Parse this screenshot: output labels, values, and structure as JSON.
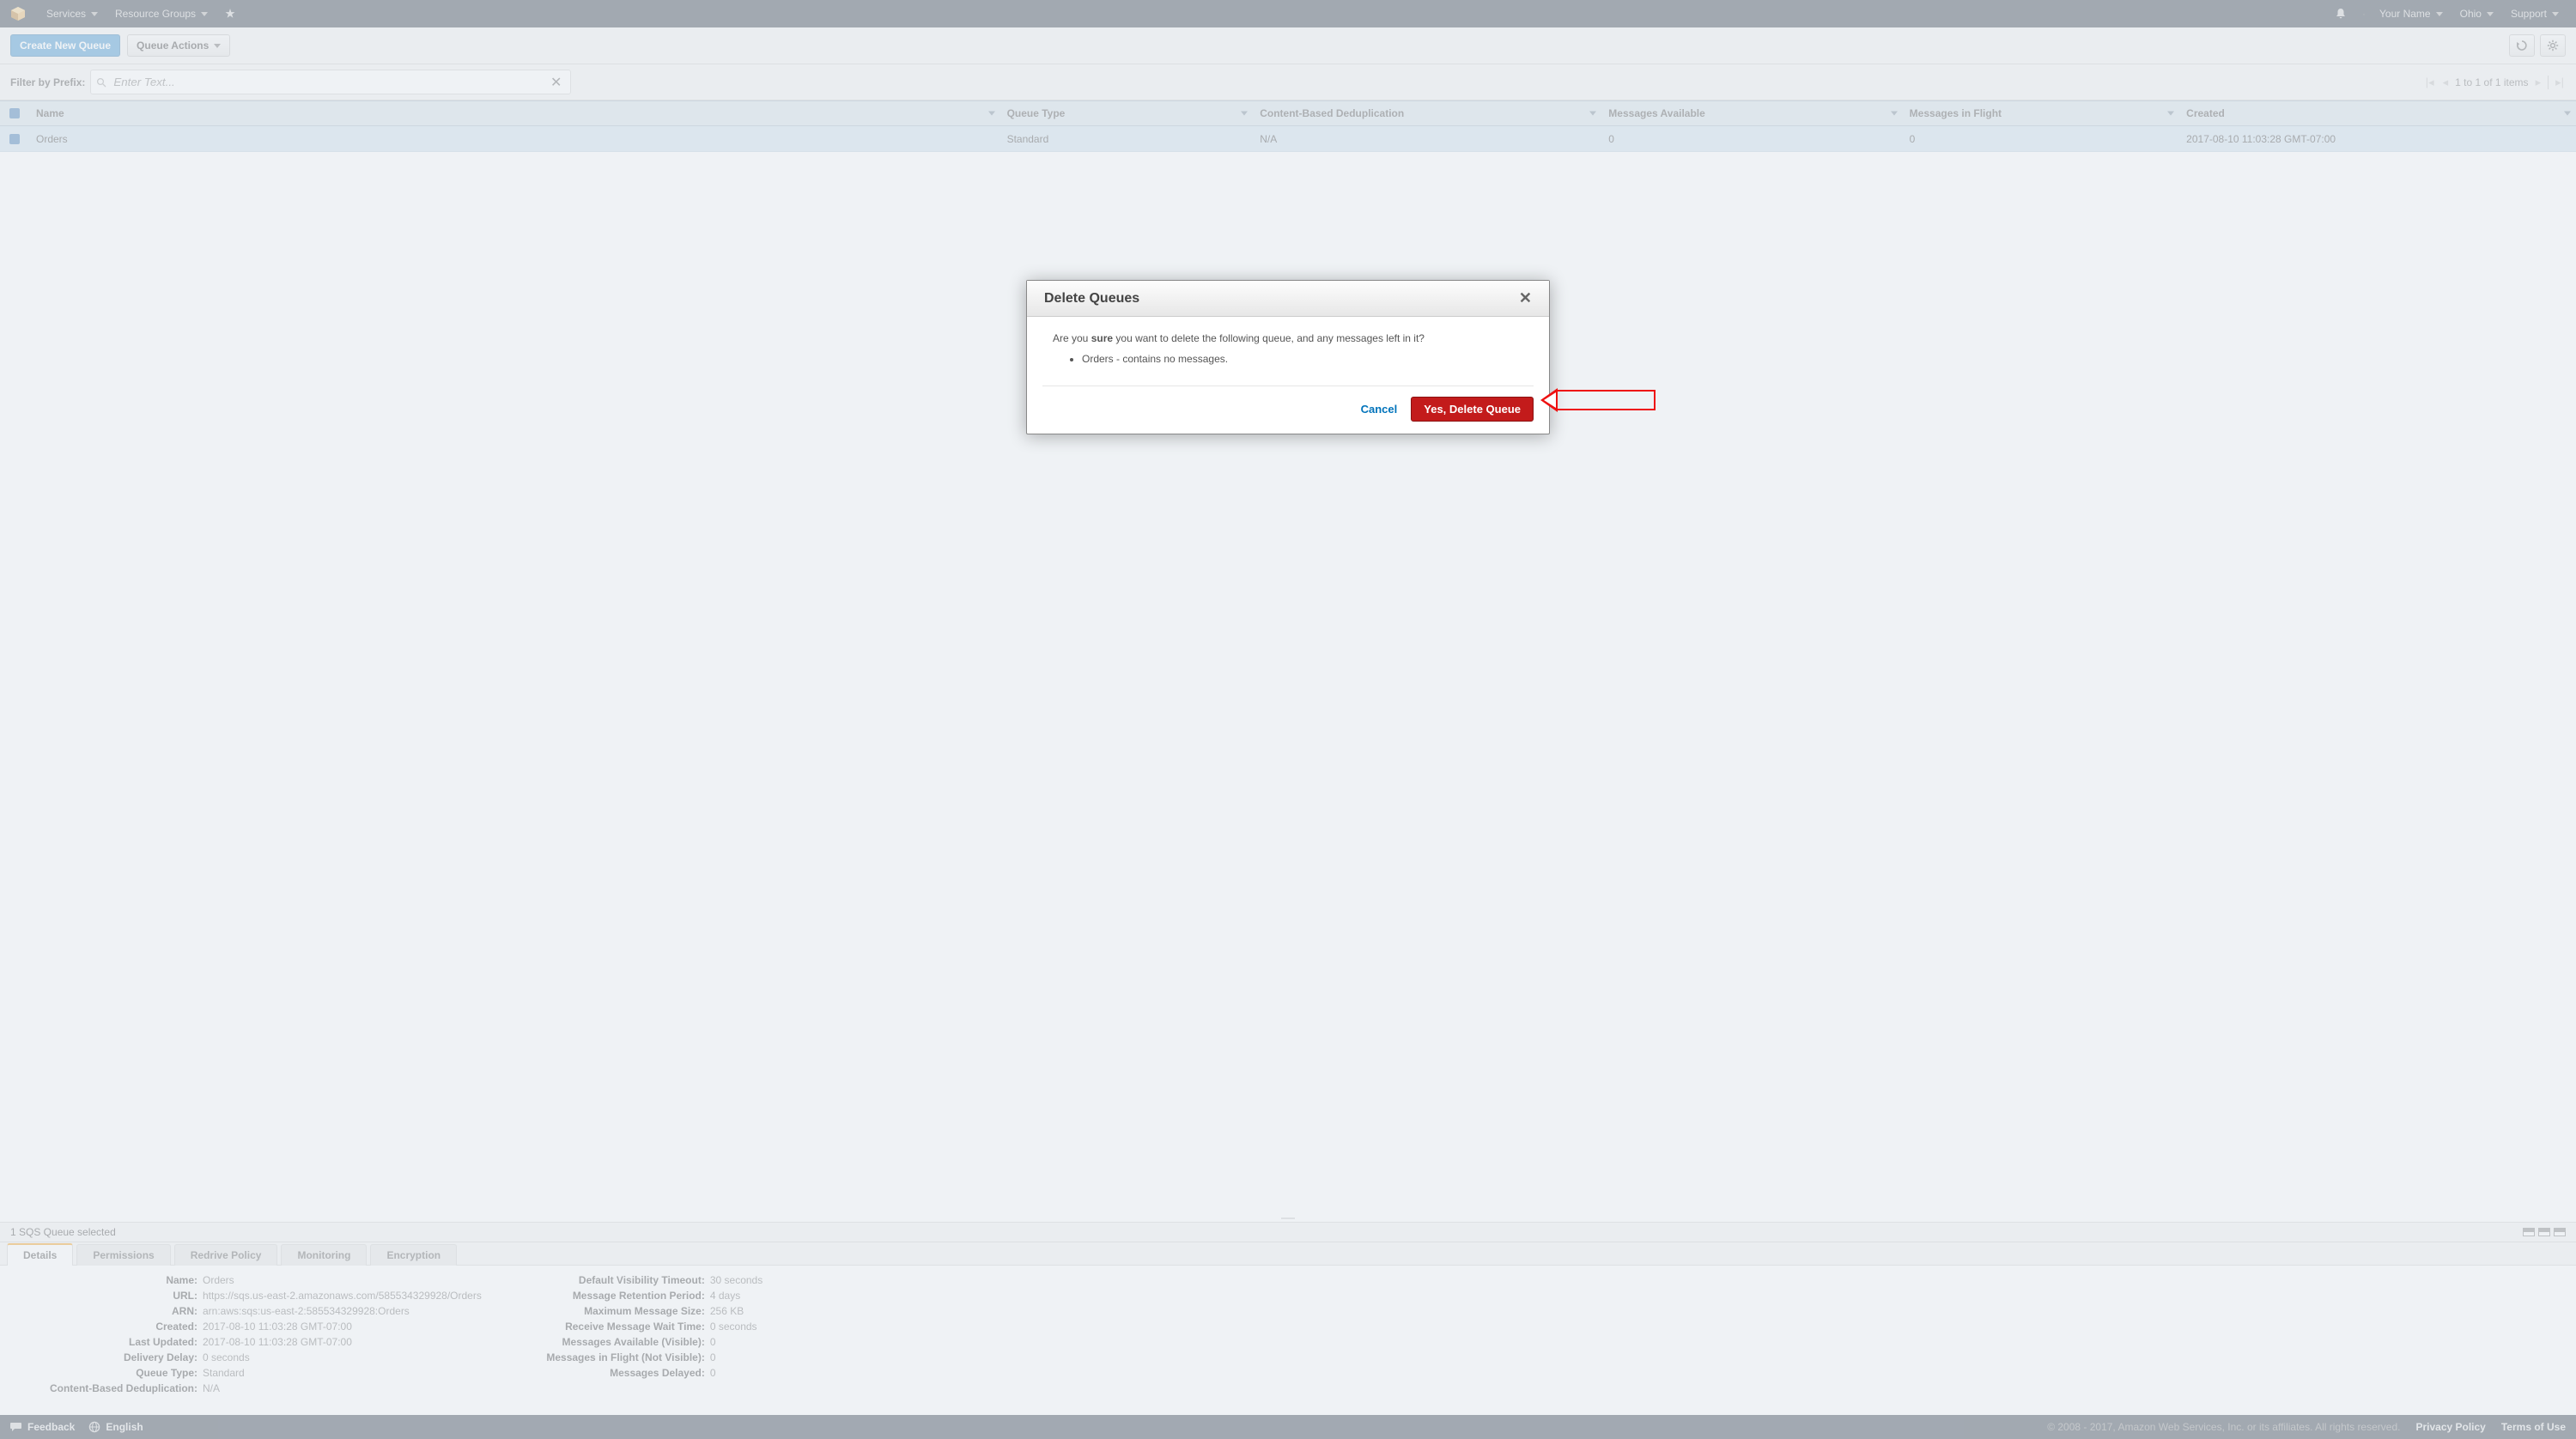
{
  "nav": {
    "services": "Services",
    "resource_groups": "Resource Groups",
    "your_name": "Your Name",
    "region": "Ohio",
    "support": "Support"
  },
  "toolbar": {
    "create": "Create New Queue",
    "actions": "Queue Actions"
  },
  "filter": {
    "label": "Filter by Prefix:",
    "placeholder": "Enter Text...",
    "pager": "1 to 1 of 1 items"
  },
  "columns": {
    "name": "Name",
    "type": "Queue Type",
    "dedup": "Content-Based Deduplication",
    "avail": "Messages Available",
    "flight": "Messages in Flight",
    "created": "Created"
  },
  "row": {
    "name": "Orders",
    "type": "Standard",
    "dedup": "N/A",
    "avail": "0",
    "flight": "0",
    "created": "2017-08-10 11:03:28 GMT-07:00"
  },
  "selbar": "1 SQS Queue selected",
  "tabs": {
    "details": "Details",
    "permissions": "Permissions",
    "redrive": "Redrive Policy",
    "monitoring": "Monitoring",
    "encryption": "Encryption"
  },
  "details": {
    "left": {
      "Name:": "Orders",
      "URL:": "https://sqs.us-east-2.amazonaws.com/585534329928/Orders",
      "ARN:": "arn:aws:sqs:us-east-2:585534329928:Orders",
      "Created:": "2017-08-10 11:03:28 GMT-07:00",
      "Last Updated:": "2017-08-10 11:03:28 GMT-07:00",
      "Delivery Delay:": "0 seconds",
      "Queue Type:": "Standard",
      "Content-Based Deduplication:": "N/A"
    },
    "right": {
      "Default Visibility Timeout:": "30 seconds",
      "Message Retention Period:": "4 days",
      "Maximum Message Size:": "256 KB",
      "Receive Message Wait Time:": "0 seconds",
      "Messages Available (Visible):": "0",
      "Messages in Flight (Not Visible):": "0",
      "Messages Delayed:": "0"
    }
  },
  "modal": {
    "title": "Delete Queues",
    "msg_pre": "Are you ",
    "msg_strong": "sure",
    "msg_post": " you want to delete the following queue, and any messages left in it?",
    "item": "Orders - contains no messages.",
    "cancel": "Cancel",
    "confirm": "Yes, Delete Queue"
  },
  "footer": {
    "feedback": "Feedback",
    "lang": "English",
    "copy": "© 2008 - 2017, Amazon Web Services, Inc. or its affiliates. All rights reserved.",
    "privacy": "Privacy Policy",
    "terms": "Terms of Use"
  }
}
